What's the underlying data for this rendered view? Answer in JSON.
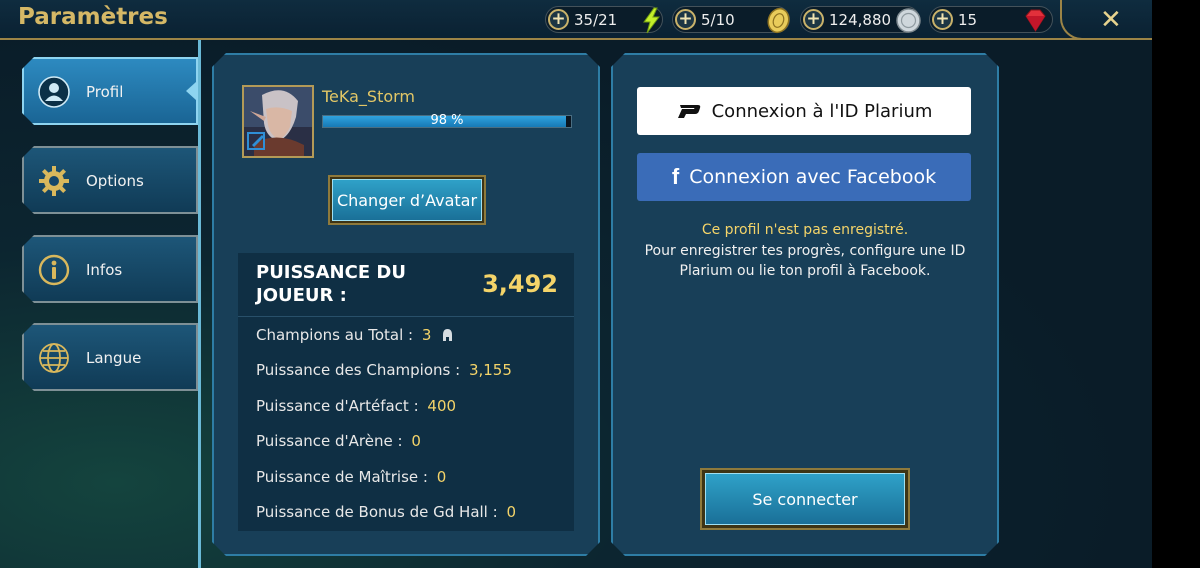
{
  "header": {
    "title": "Paramètres",
    "resources": [
      {
        "value": "35/21",
        "icon": "energy-icon"
      },
      {
        "value": "5/10",
        "icon": "arena-token-icon"
      },
      {
        "value": "124,880",
        "icon": "silver-icon"
      },
      {
        "value": "15",
        "icon": "gem-icon"
      }
    ],
    "close_icon": "close-icon"
  },
  "sidebar": {
    "items": [
      {
        "label": "Profil",
        "icon": "profile-icon",
        "active": true
      },
      {
        "label": "Options",
        "icon": "gear-icon",
        "active": false
      },
      {
        "label": "Infos",
        "icon": "info-icon",
        "active": false
      },
      {
        "label": "Langue",
        "icon": "globe-icon",
        "active": false
      }
    ]
  },
  "profile": {
    "username": "TeKa_Storm",
    "xp_percent": 98,
    "xp_label": "98 %",
    "change_avatar_label": "Changer d’Avatar",
    "power_label": "PUISSANCE DU JOUEUR :",
    "power_value": "3,492",
    "stats": [
      {
        "label": "Champions au Total :",
        "value": "3"
      },
      {
        "label": "Puissance des Champions :",
        "value": "3,155"
      },
      {
        "label": "Puissance d'Artéfact :",
        "value": "400"
      },
      {
        "label": "Puissance d'Arène :",
        "value": "0"
      },
      {
        "label": "Puissance de Maîtrise :",
        "value": "0"
      },
      {
        "label": "Puissance de Bonus de Gd Hall :",
        "value": "0"
      }
    ]
  },
  "account": {
    "plarium_label": "Connexion à l'ID Plarium",
    "facebook_label": "Connexion avec Facebook",
    "unregistered": "Ce profil n'est pas enregistré.",
    "hint": "Pour enregistrer tes progrès, configure une ID Plarium ou lie ton profil à Facebook.",
    "connect_label": "Se connecter"
  },
  "colors": {
    "gold": "#f4d469",
    "accent_blue": "#2fa1c8",
    "facebook": "#3a6cb8"
  }
}
